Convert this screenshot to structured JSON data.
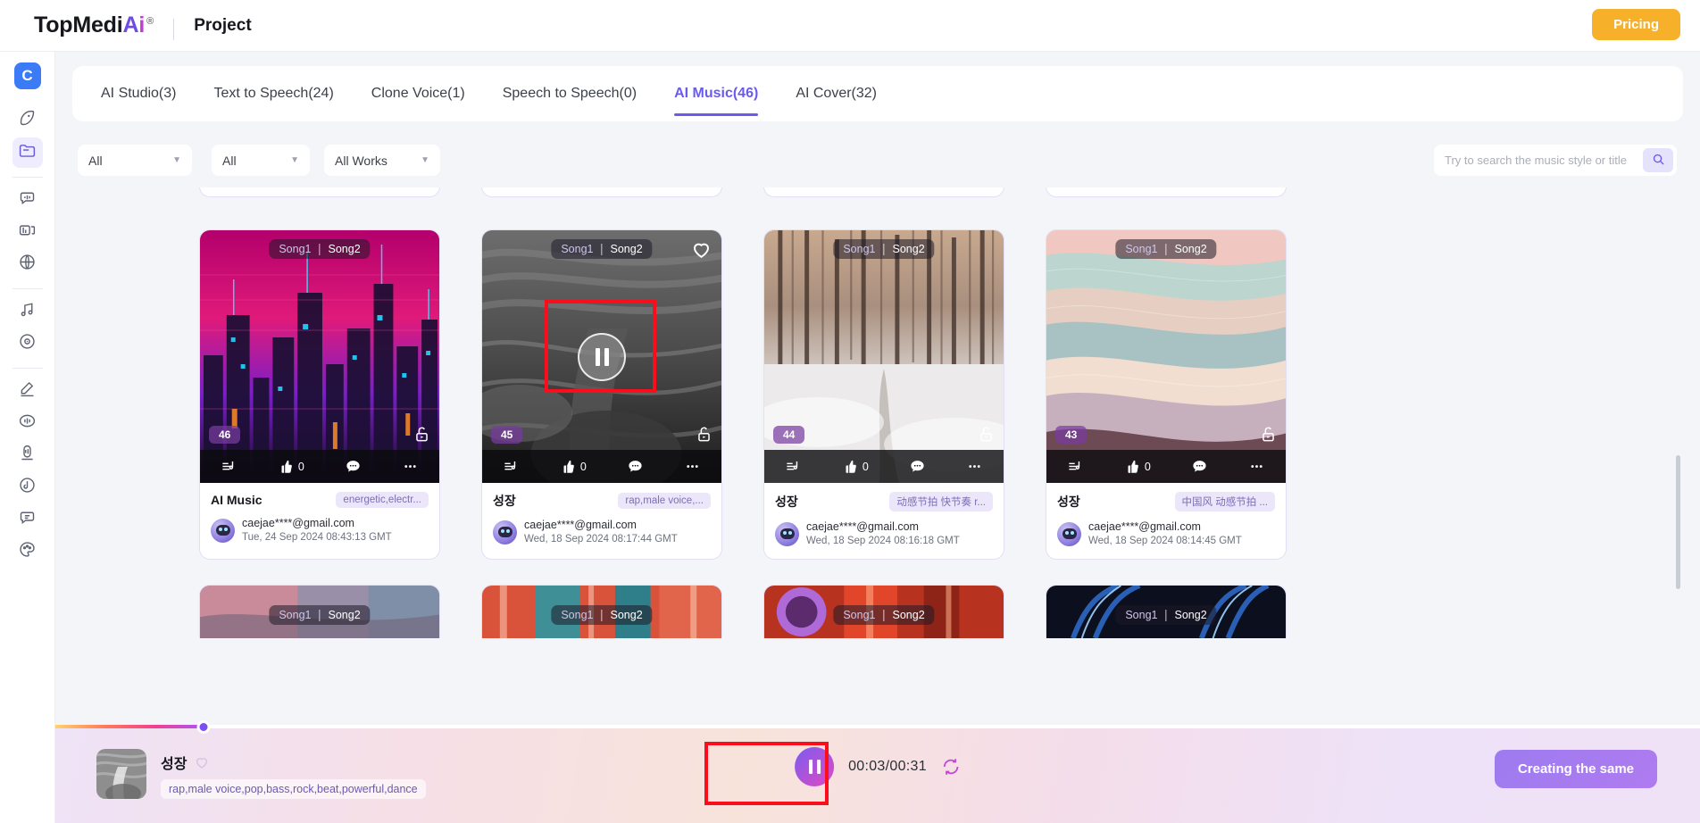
{
  "header": {
    "brand_top": "TopMedi",
    "brand_a": "A",
    "brand_i": "i",
    "brand_reg": "®",
    "project_title": "Project",
    "pricing_label": "Pricing"
  },
  "rail": {
    "logo_label": "C",
    "items": [
      {
        "name": "explore-icon"
      },
      {
        "name": "folder-icon"
      },
      {
        "name": "text-to-speech-icon"
      },
      {
        "name": "voice-library-icon"
      },
      {
        "name": "translate-globe-icon"
      },
      {
        "name": "music-note-icon"
      },
      {
        "name": "disc-icon"
      },
      {
        "name": "microphone-edit-icon"
      },
      {
        "name": "voice-wave-icon"
      },
      {
        "name": "recorder-icon"
      },
      {
        "name": "voice-clone-icon"
      },
      {
        "name": "speech-bubble-icon"
      },
      {
        "name": "palette-icon"
      }
    ]
  },
  "tabs": [
    {
      "label": "AI Studio(3)",
      "active": false
    },
    {
      "label": "Text to Speech(24)",
      "active": false
    },
    {
      "label": "Clone Voice(1)",
      "active": false
    },
    {
      "label": "Speech to Speech(0)",
      "active": false
    },
    {
      "label": "AI Music(46)",
      "active": true
    },
    {
      "label": "AI Cover(32)",
      "active": false
    }
  ],
  "filters": {
    "dropdown1": "All",
    "dropdown2": "All",
    "dropdown3": "All Works",
    "caret": "▼"
  },
  "search": {
    "placeholder": "Try to search the music style or title",
    "value": ""
  },
  "cards": [
    {
      "index_badge": "46",
      "song_left": "Song1",
      "song_right": "Song2",
      "like_count": "0",
      "title": "AI Music",
      "tag": "energetic,electr...",
      "email": "caejae****@gmail.com",
      "date": "Tue, 24 Sep 2024 08:43:13 GMT",
      "favorited": false,
      "playing": false
    },
    {
      "index_badge": "45",
      "song_left": "Song1",
      "song_right": "Song2",
      "like_count": "0",
      "title": "성장",
      "tag": "rap,male voice,...",
      "email": "caejae****@gmail.com",
      "date": "Wed, 18 Sep 2024 08:17:44 GMT",
      "favorited": true,
      "playing": true
    },
    {
      "index_badge": "44",
      "song_left": "Song1",
      "song_right": "Song2",
      "like_count": "0",
      "title": "성장",
      "tag": "动感节拍 快节奏 r...",
      "email": "caejae****@gmail.com",
      "date": "Wed, 18 Sep 2024 08:16:18 GMT",
      "favorited": false,
      "playing": false
    },
    {
      "index_badge": "43",
      "song_left": "Song1",
      "song_right": "Song2",
      "like_count": "0",
      "title": "성장",
      "tag": "中国风 动感节拍 ...",
      "email": "caejae****@gmail.com",
      "date": "Wed, 18 Sep 2024 08:14:45 GMT",
      "favorited": false,
      "playing": false
    }
  ],
  "next_row": [
    {
      "song_left": "Song1",
      "song_right": "Song2"
    },
    {
      "song_left": "Song1",
      "song_right": "Song2"
    },
    {
      "song_left": "Song1",
      "song_right": "Song2"
    },
    {
      "song_left": "Song1",
      "song_right": "Song2"
    }
  ],
  "player": {
    "title": "성장",
    "tags": "rap,male voice,pop,bass,rock,beat,powerful,dance",
    "current_time": "00:03",
    "separator": "/",
    "total_time": "00:31",
    "time_display": "00:03/00:31",
    "create_label": "Creating the same",
    "progress_percent": 9
  },
  "colors": {
    "accent": "#6a5bee",
    "pricing": "#f6b02a",
    "highlight_box": "#fc0d1b",
    "tag_bg": "#ece6fb",
    "player_button": "#b07bf0"
  }
}
